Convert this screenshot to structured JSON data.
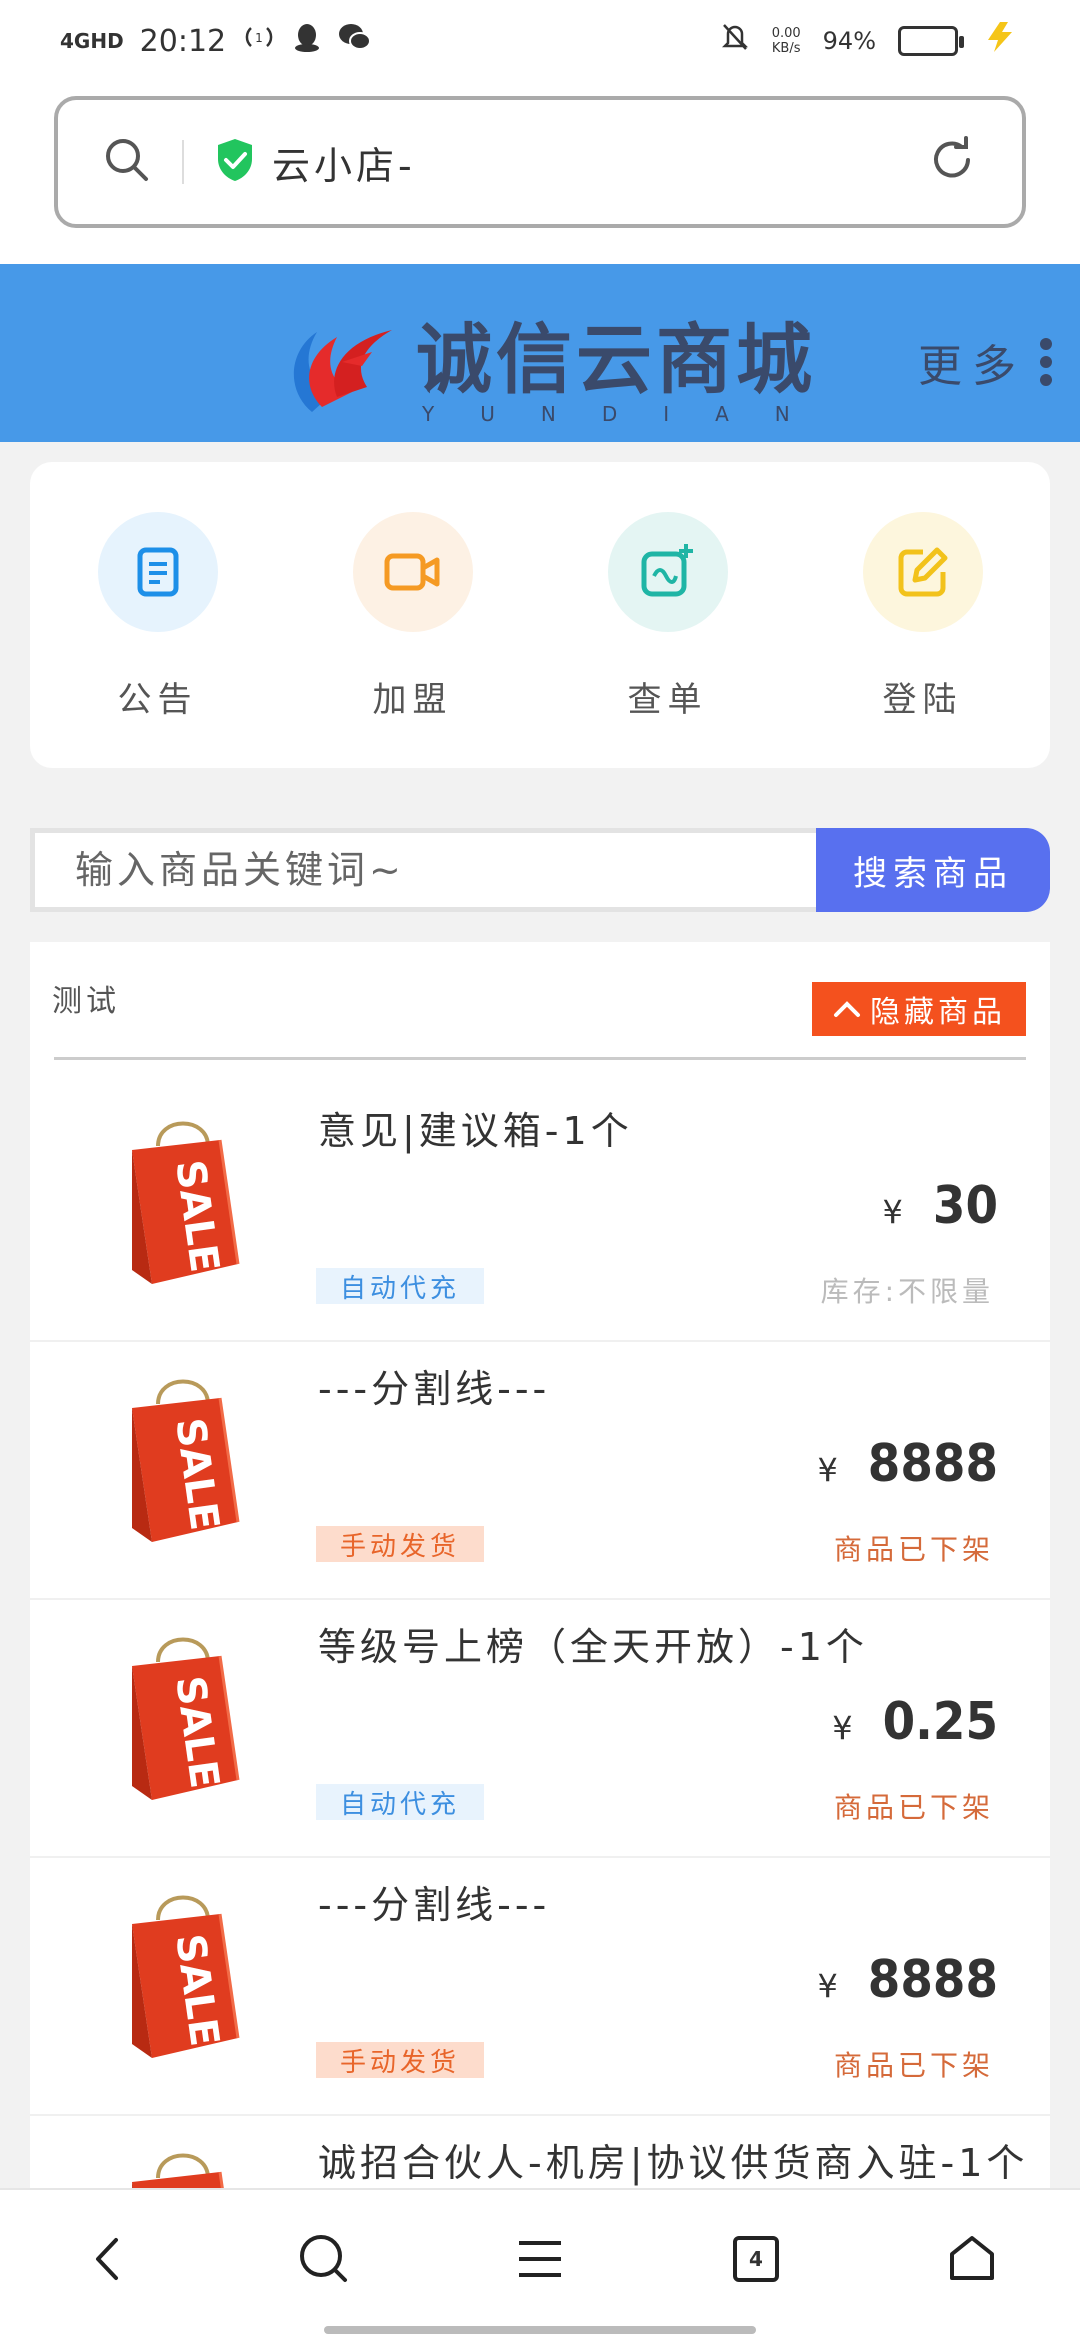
{
  "status_bar": {
    "network": "4GHD",
    "time": "20:12",
    "speed": "0.00",
    "speed_unit": "KB/s",
    "battery": "94%",
    "battery_level": 0.94
  },
  "browser": {
    "url_text": "云小店-"
  },
  "site": {
    "logo_title": "诚信云商城",
    "logo_sub": "YUNDIAN",
    "more_label": "更多"
  },
  "quick_menu": [
    {
      "label": "公告",
      "icon": "document-icon",
      "color": "#1d8fe8",
      "bg": "#e6f3fd"
    },
    {
      "label": "加盟",
      "icon": "video-icon",
      "color": "#f59a23",
      "bg": "#fdf1e4"
    },
    {
      "label": "查单",
      "icon": "add-link-icon",
      "color": "#1fb5a5",
      "bg": "#e4f5f3"
    },
    {
      "label": "登陆",
      "icon": "edit-icon",
      "color": "#f2c21b",
      "bg": "#fdf6dd"
    }
  ],
  "search": {
    "placeholder": "输入商品关键词~",
    "button_label": "搜索商品"
  },
  "panel": {
    "title": "测试",
    "hide_label": "隐藏商品"
  },
  "products": [
    {
      "name": "意见|建议箱-1个",
      "currency": "¥",
      "price": "30",
      "tag": "自动代充",
      "tag_type": "auto",
      "stock": "库存:不限量",
      "stock_type": "normal"
    },
    {
      "name": "---分割线---",
      "currency": "¥",
      "price": "8888",
      "tag": "手动发货",
      "tag_type": "manual",
      "stock": "商品已下架",
      "stock_type": "off"
    },
    {
      "name": "等级号上榜（全天开放）-1个",
      "currency": "¥",
      "price": "0.25",
      "tag": "自动代充",
      "tag_type": "auto",
      "stock": "商品已下架",
      "stock_type": "off"
    },
    {
      "name": "---分割线---",
      "currency": "¥",
      "price": "8888",
      "tag": "手动发货",
      "tag_type": "manual",
      "stock": "商品已下架",
      "stock_type": "off"
    },
    {
      "name": "诚招合伙人-机房|协议供货商入驻-1个",
      "currency": "",
      "price": "",
      "tag": "",
      "tag_type": "",
      "stock": "",
      "stock_type": ""
    }
  ],
  "bottom_nav": {
    "tab_count": "4"
  }
}
